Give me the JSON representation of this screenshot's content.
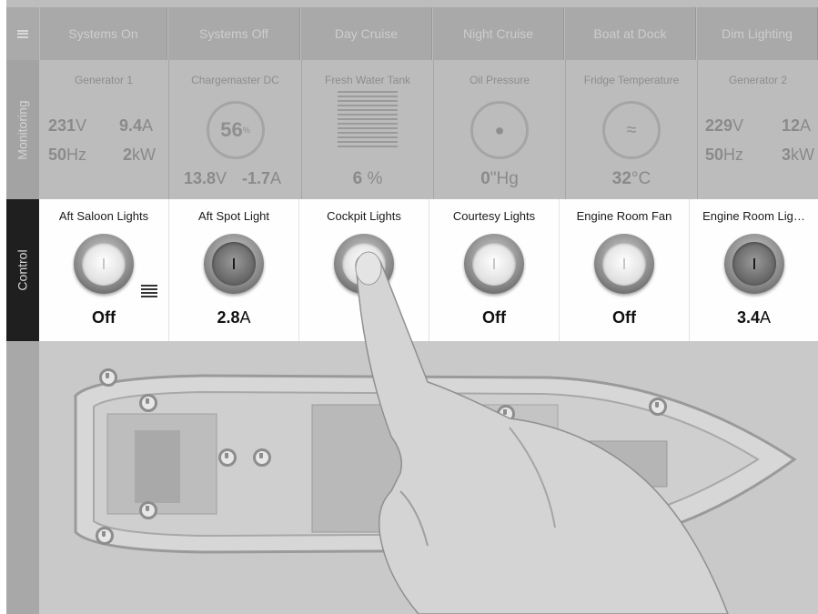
{
  "presets": [
    "Systems On",
    "Systems Off",
    "Day Cruise",
    "Night Cruise",
    "Boat at Dock",
    "Dim Lighting"
  ],
  "tabs": {
    "monitoring": "Monitoring",
    "control": "Control"
  },
  "monitoring": {
    "generator1": {
      "title": "Generator 1",
      "volts": "231",
      "volts_unit": "V",
      "amps": "9.4",
      "amps_unit": "A",
      "hz": "50",
      "hz_unit": "Hz",
      "kw": "2",
      "kw_unit": "kW"
    },
    "chargemaster": {
      "title": "Chargemaster DC",
      "gauge": "56",
      "gauge_unit": "%",
      "volts": "13.8",
      "volts_unit": "V",
      "amps": "-1.7",
      "amps_unit": "A"
    },
    "water_tank": {
      "title": "Fresh Water Tank",
      "value": "6",
      "unit": "%"
    },
    "oil_pressure": {
      "title": "Oil Pressure",
      "value": "0",
      "unit": "\"Hg"
    },
    "fridge": {
      "title": "Fridge Temperature",
      "value": "32",
      "unit": "°C"
    },
    "generator2": {
      "title": "Generator 2",
      "volts": "229",
      "volts_unit": "V",
      "amps": "12",
      "amps_unit": "A",
      "hz": "50",
      "hz_unit": "Hz",
      "kw": "3",
      "kw_unit": "kW"
    }
  },
  "control": [
    {
      "title": "Aft Saloon Lights",
      "value": "Off",
      "unit": "",
      "state": "off"
    },
    {
      "title": "Aft Spot Light",
      "value": "2.8",
      "unit": "A",
      "state": "on"
    },
    {
      "title": "Cockpit Lights",
      "value": "",
      "unit": "",
      "state": "off"
    },
    {
      "title": "Courtesy Lights",
      "value": "Off",
      "unit": "",
      "state": "off"
    },
    {
      "title": "Engine Room Fan",
      "value": "Off",
      "unit": "",
      "state": "off"
    },
    {
      "title": "Engine Room Lig…",
      "value": "3.4",
      "unit": "A",
      "state": "on"
    }
  ],
  "icons": {
    "menu": "menu-icon",
    "list": "list-icon",
    "pin": "location-pin-icon",
    "oil": "oil-can-icon",
    "thermometer": "thermometer-icon"
  }
}
